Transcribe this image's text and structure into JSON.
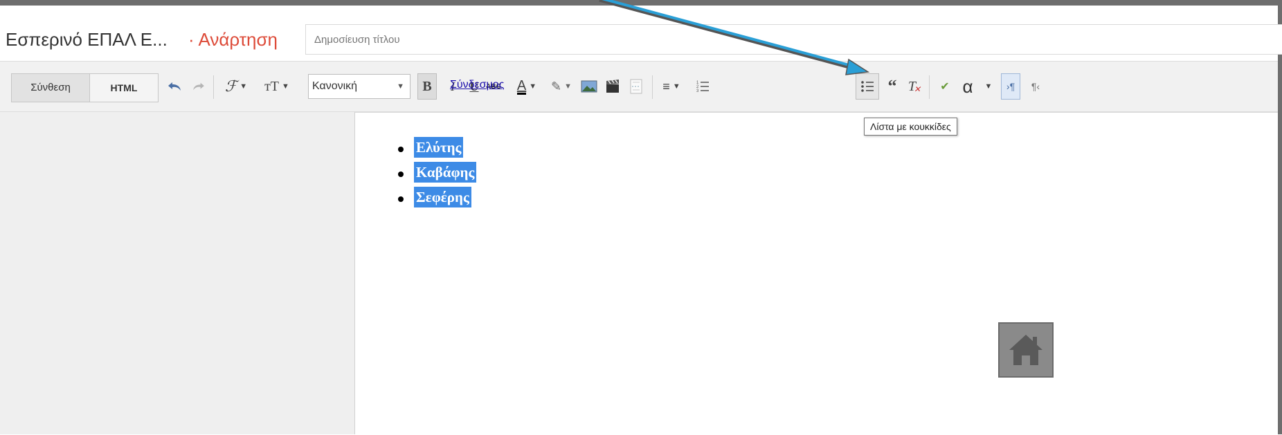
{
  "header": {
    "blog_name": "Εσπερινό ΕΠΑΛ Ε...",
    "post_label": "· Ανάρτηση",
    "title_placeholder": "Δημοσίευση τίτλου"
  },
  "toolbar": {
    "mode_compose": "Σύνθεση",
    "mode_html": "HTML",
    "font_size_value": "Κανονική",
    "link_label": "Σύνδεσμος",
    "special_char_label": "α"
  },
  "editor": {
    "list_items": [
      "Ελύτης",
      "Καβάφης",
      "Σεφέρης"
    ]
  },
  "tooltip": {
    "text": "Λίστα με κουκκίδες"
  },
  "icons": [
    "undo-icon",
    "redo-icon",
    "font-family-icon",
    "font-size-icon",
    "bold-icon",
    "italic-icon",
    "underline-icon",
    "strikethrough-icon",
    "text-color-icon",
    "highlight-icon",
    "image-icon",
    "video-icon",
    "jump-break-icon",
    "align-icon",
    "numbered-list-icon",
    "bulleted-list-icon",
    "quote-icon",
    "clear-formatting-icon",
    "spellcheck-icon",
    "ltr-icon",
    "rtl-icon",
    "home-icon"
  ],
  "colors": {
    "accent": "#dd4b39",
    "selection": "#3d8be6",
    "arrow": "#2a9fd6",
    "link": "#1a0dab"
  }
}
